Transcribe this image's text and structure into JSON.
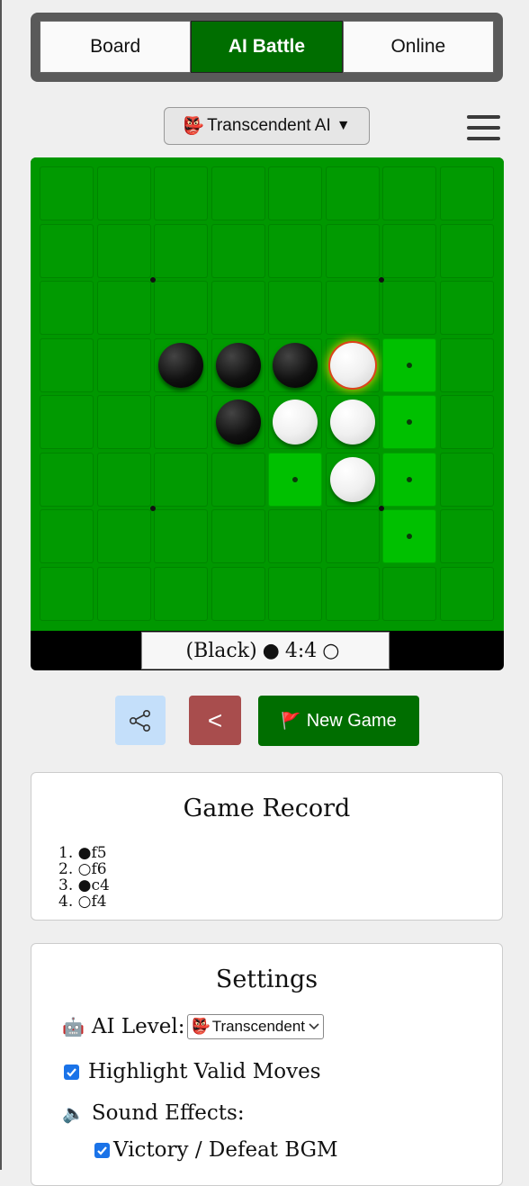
{
  "tabs": [
    "Board",
    "AI Battle",
    "Online"
  ],
  "ai_selector": {
    "emoji": "👺",
    "label": "Transcendent AI",
    "arrow": "▼"
  },
  "menu_icon": "hamburger-icon",
  "board": {
    "size": 8,
    "black": [
      [
        3,
        2
      ],
      [
        3,
        3
      ],
      [
        3,
        4
      ],
      [
        4,
        3
      ]
    ],
    "white": [
      [
        3,
        5
      ],
      [
        4,
        4
      ],
      [
        4,
        5
      ],
      [
        5,
        5
      ]
    ],
    "last_move": [
      3,
      5
    ],
    "valid_moves": [
      [
        3,
        6
      ],
      [
        4,
        6
      ],
      [
        5,
        4
      ],
      [
        5,
        6
      ],
      [
        6,
        6
      ]
    ]
  },
  "score": {
    "label": "(Black)",
    "black_symbol": "●",
    "black": "4",
    "separator": ":",
    "white": "4",
    "white_symbol": "○"
  },
  "buttons": {
    "share_icon": "share-icon",
    "back_label": "<",
    "new_game_icon": "🚩",
    "new_game_label": "New Game"
  },
  "game_record": {
    "title": "Game Record",
    "moves": [
      "1. ●f5",
      "2. ○f6",
      "3. ●c4",
      "4. ○f4"
    ]
  },
  "settings": {
    "title": "Settings",
    "ai_level_icon": "🤖",
    "ai_level_label": "AI Level:",
    "ai_level_value_emoji": "👺",
    "ai_level_value": "Transcendent",
    "highlight_label": "Highlight Valid Moves",
    "highlight_checked": true,
    "sound_icon": "🔈",
    "sound_label": "Sound Effects:",
    "bgm_label": "Victory / Defeat BGM",
    "bgm_checked": true
  },
  "colors": {
    "accent_green": "#006e00",
    "board_green": "#019a01",
    "valid_green": "#00c000",
    "back_red": "#a84d4d",
    "share_blue": "#c4dffa"
  }
}
